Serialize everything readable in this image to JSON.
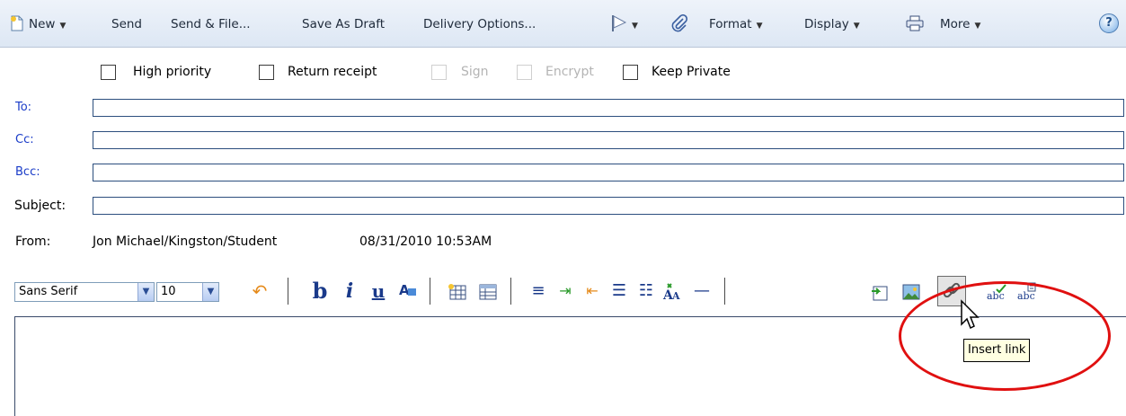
{
  "toolbar": {
    "new_label": "New",
    "send_label": "Send",
    "send_file_label": "Send & File...",
    "save_draft_label": "Save As Draft",
    "delivery_label": "Delivery Options...",
    "format_label": "Format",
    "display_label": "Display",
    "more_label": "More",
    "help_glyph": "?"
  },
  "options": {
    "high_priority": "High priority",
    "return_receipt": "Return receipt",
    "sign": "Sign",
    "encrypt": "Encrypt",
    "keep_private": "Keep Private"
  },
  "address": {
    "to_label": "To:",
    "cc_label": "Cc:",
    "bcc_label": "Bcc:",
    "subject_label": "Subject:"
  },
  "from": {
    "label": "From:",
    "name": "Jon Michael/Kingston/Student",
    "datetime": "08/31/2010 10:53AM"
  },
  "format_bar": {
    "font_family": "Sans Serif",
    "font_size": "10"
  },
  "tooltip": {
    "text": "Insert link"
  },
  "colors": {
    "label_blue": "#1a3cc8",
    "annotation_red": "#e01010"
  }
}
